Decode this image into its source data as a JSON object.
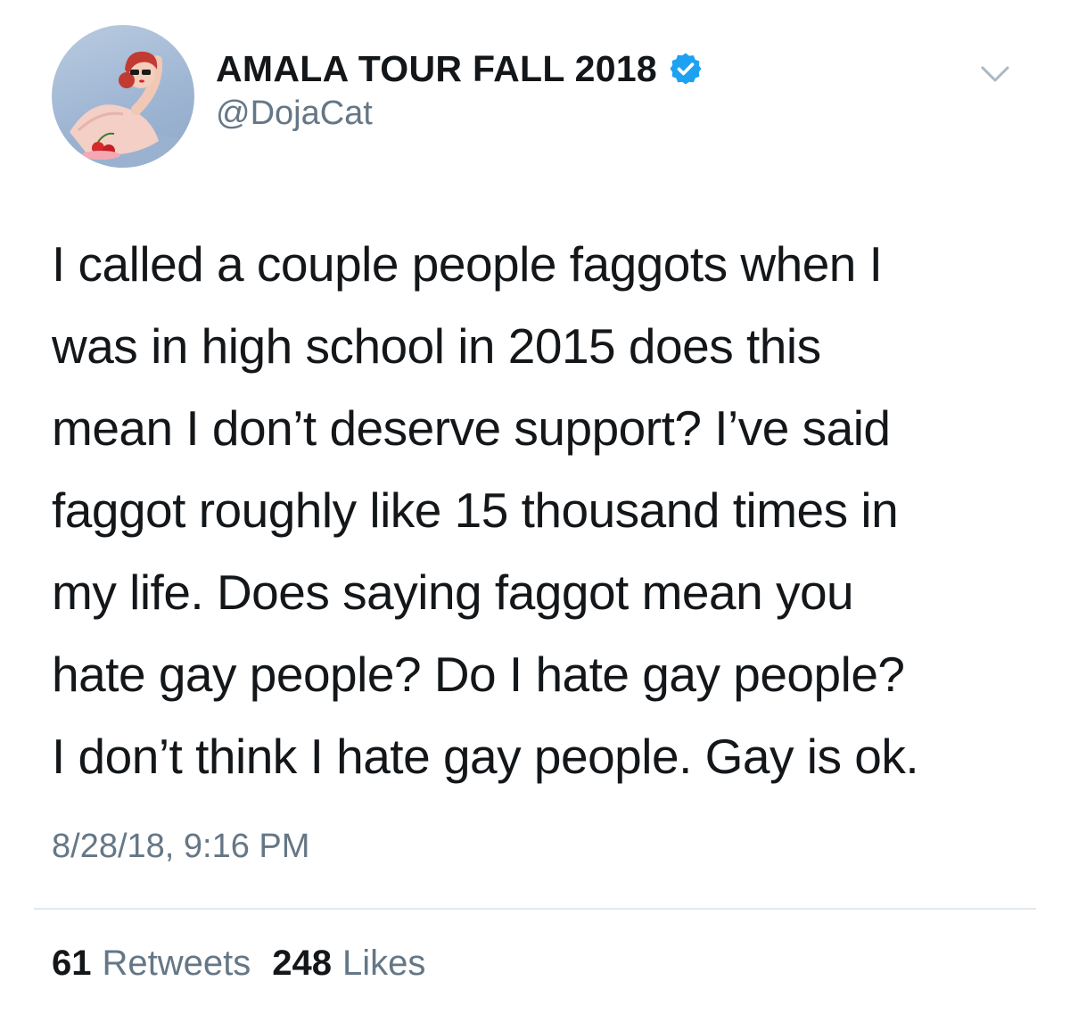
{
  "tweet": {
    "author": {
      "display_name": "AMALA TOUR FALL 2018",
      "handle": "@DojaCat",
      "verified": true,
      "avatar_icon": "profile-avatar"
    },
    "menu_icon": "chevron-down-icon",
    "text_lines": [
      "I called a couple people faggots when I",
      "was in high school in 2015 does this",
      "mean I don’t deserve support? I’ve said",
      "faggot roughly like 15 thousand times in",
      "my life. Does saying faggot mean you",
      "hate gay people? Do I hate gay people?",
      "I don’t think I hate gay people. Gay is ok."
    ],
    "timestamp": "8/28/18, 9:16 PM",
    "stats": {
      "retweets_count": "61",
      "retweets_label": "Retweets",
      "likes_count": "248",
      "likes_label": "Likes"
    }
  },
  "colors": {
    "text_primary": "#14171a",
    "text_secondary": "#657786",
    "verified_blue": "#1da1f2",
    "divider": "#e1e8ed",
    "background": "#ffffff"
  }
}
